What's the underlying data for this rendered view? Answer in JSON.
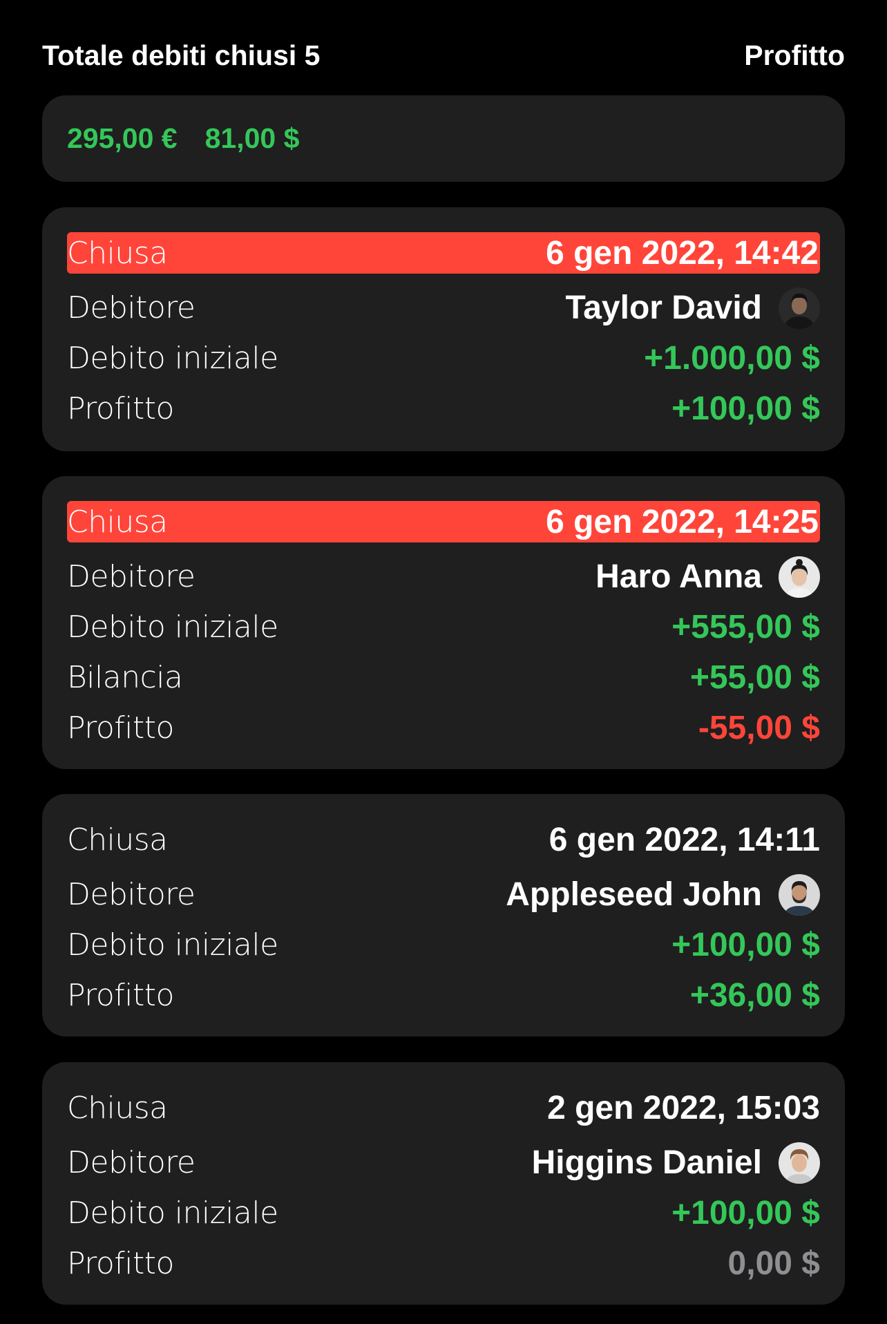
{
  "header": {
    "title": "Totale debiti chiusi 5",
    "right_label": "Profitto"
  },
  "summary": {
    "amount_eur": "295,00 €",
    "amount_usd": "81,00 $",
    "color": "#34c759"
  },
  "labels": {
    "closed": "Chiusa",
    "debtor": "Debitore",
    "initial_debt": "Debito iniziale",
    "balance": "Bilancia",
    "profit": "Profitto"
  },
  "colors": {
    "green": "#34c759",
    "red": "#ff453a",
    "gray": "#8e8e93",
    "card_bg": "#1f1f1f"
  },
  "debts": [
    {
      "highlighted": true,
      "date": "6 gen 2022, 14:42",
      "debtor": "Taylor David",
      "avatar_icon": "avatar-man-dark-icon",
      "initial_debt": "+1.000,00 $",
      "profit": "+100,00 $",
      "profit_color": "green"
    },
    {
      "highlighted": true,
      "date": "6 gen 2022, 14:25",
      "debtor": "Haro Anna",
      "avatar_icon": "avatar-woman-icon",
      "initial_debt": "+555,00 $",
      "balance": "+55,00 $",
      "profit": "-55,00 $",
      "profit_color": "red"
    },
    {
      "highlighted": false,
      "date": "6 gen 2022, 14:11",
      "debtor": "Appleseed John",
      "avatar_icon": "avatar-man-beard-icon",
      "initial_debt": "+100,00 $",
      "profit": "+36,00 $",
      "profit_color": "green"
    },
    {
      "highlighted": false,
      "date": "2 gen 2022, 15:03",
      "debtor": "Higgins Daniel",
      "avatar_icon": "avatar-man-light-icon",
      "initial_debt": "+100,00 $",
      "profit": "0,00 $",
      "profit_color": "gray"
    }
  ]
}
